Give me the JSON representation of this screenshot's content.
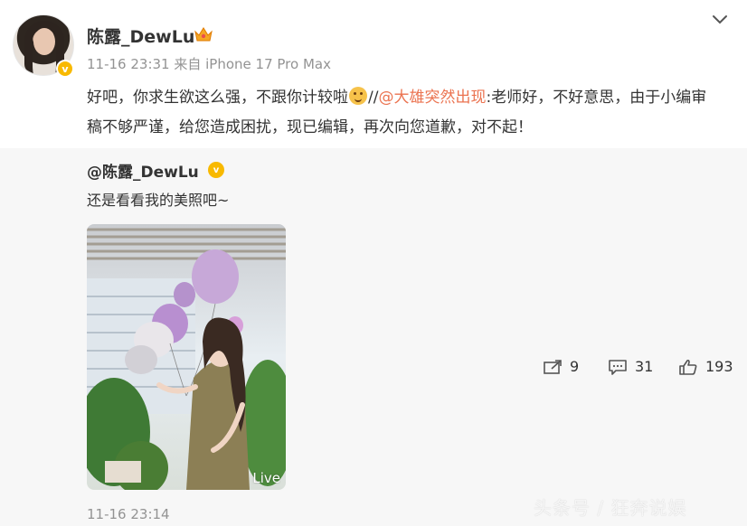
{
  "post": {
    "username": "陈露_DewLu",
    "timestamp": "11-16 23:31",
    "source": "来自 iPhone 17 Pro Max",
    "text_part1": "好吧，你求生欲这么强，不跟你计较啦",
    "text_sep": "//",
    "mention": "@大雄突然出现",
    "text_part2": ":老师好，不好意思，由于小编审稿不够严谨，给您造成困扰，现已编辑，再次向您道歉，对不起！"
  },
  "repost": {
    "username": "@陈露_DewLu",
    "text": "还是看看我的美照吧~",
    "photo_label": "Live",
    "timestamp": "11-16 23:14"
  },
  "actions": {
    "share_count": "9",
    "comment_count": "31",
    "like_count": "193"
  },
  "watermark": "头条号 / 狂奔说娱",
  "icons": {
    "crown": "crown-icon",
    "chevron": "chevron-down-icon",
    "share": "share-icon",
    "comment": "comment-icon",
    "like": "like-icon",
    "verified": "verified-icon",
    "emoji": "emoji-icon"
  },
  "colors": {
    "mention": "#eb7350",
    "meta": "#939393",
    "repost_bg": "#f7f7f7",
    "verified": "#f8b900"
  }
}
